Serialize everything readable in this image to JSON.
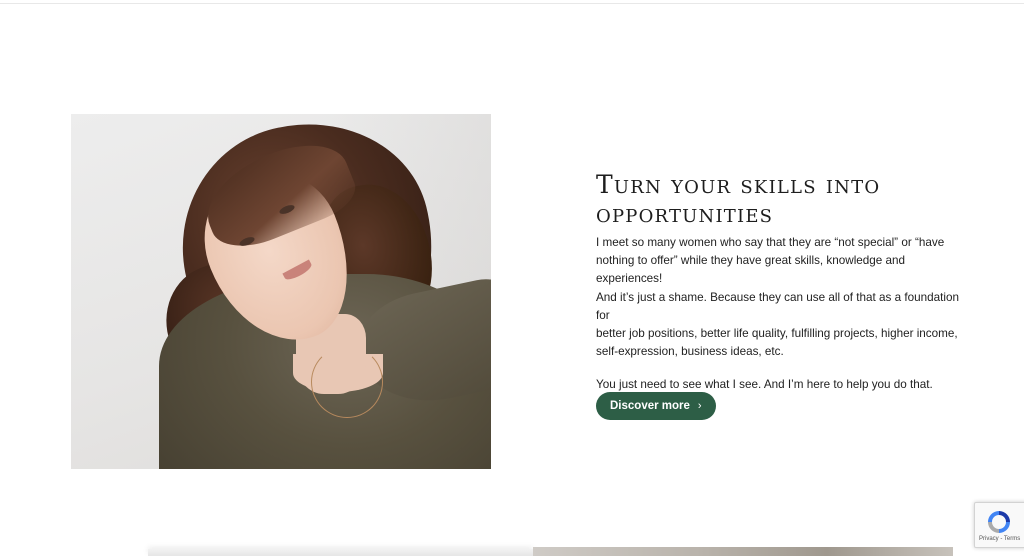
{
  "section": {
    "heading": "Turn your skills into opportunities",
    "paragraph1": "I meet so many women who say that they are “not special” or “have\nnothing to offer” while they have great skills, knowledge and experiences!\nAnd it’s just a shame. Because they can use all of that as a foundation for\nbetter job positions, better life quality, fulfilling projects, higher income,\nself-expression, business ideas, etc.",
    "paragraph2": "You just need to see what I see. And I’m here to help you do that.",
    "button_label": "Discover more",
    "button_icon": "chevron-right-icon",
    "button_color": "#2d5e46"
  },
  "recaptcha": {
    "links": "Privacy - Terms",
    "icon": "recaptcha-icon"
  }
}
